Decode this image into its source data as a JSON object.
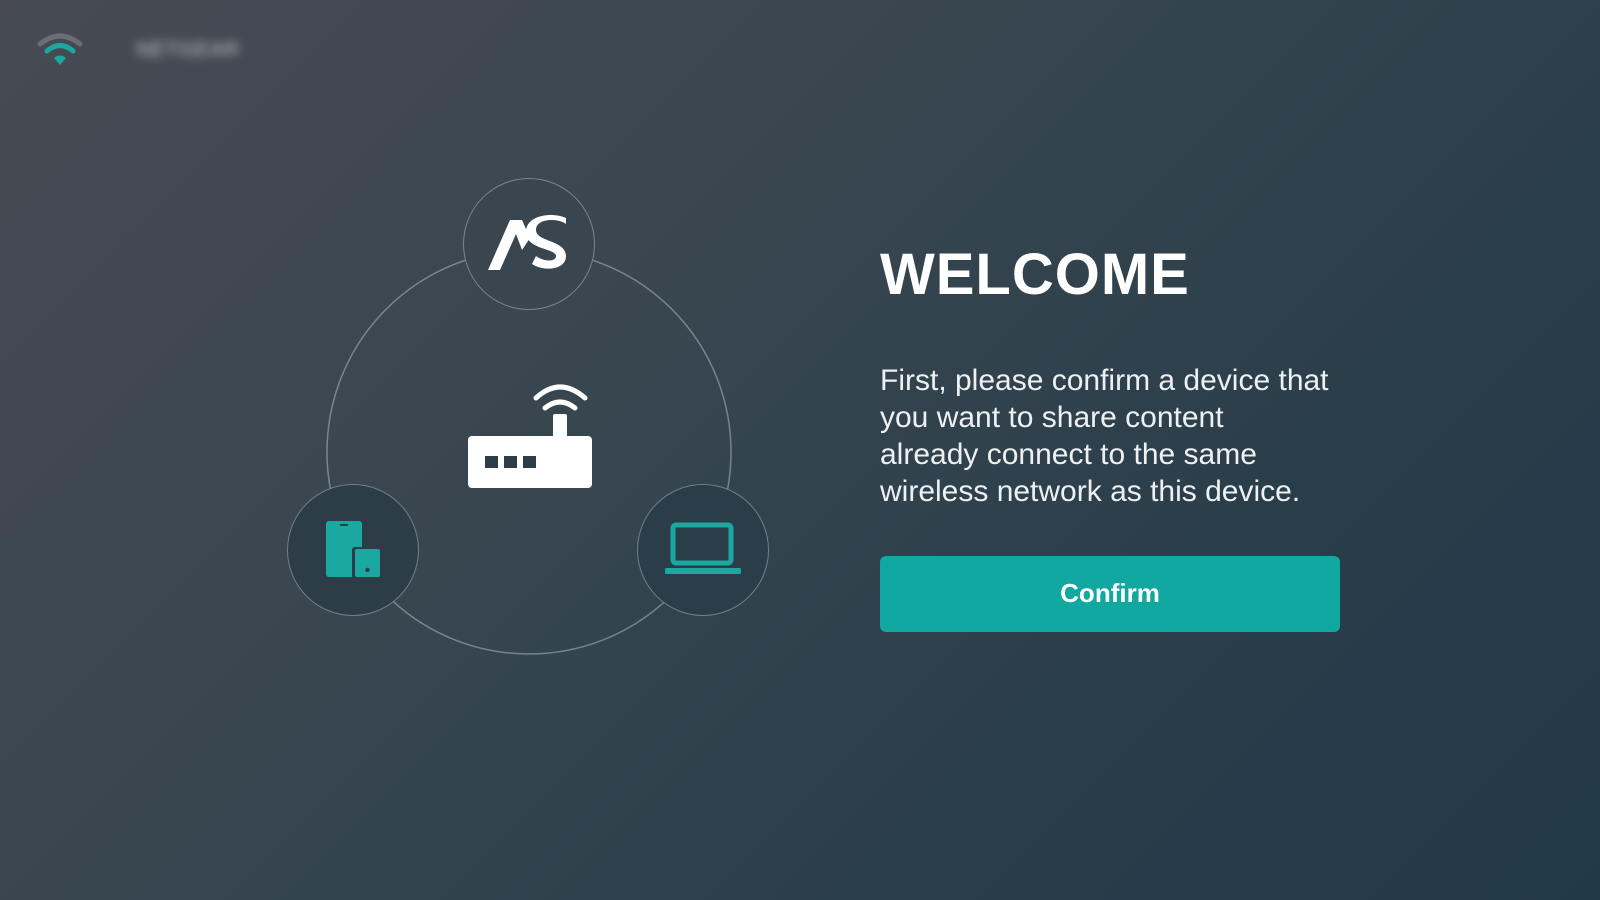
{
  "status_bar": {
    "wifi_icon": "wifi-icon",
    "network_name": "NETGEAR"
  },
  "diagram": {
    "center_icon": "router-icon",
    "nodes": [
      {
        "icon": "as-logo-icon",
        "text": "AS"
      },
      {
        "icon": "mobile-devices-icon"
      },
      {
        "icon": "laptop-icon"
      }
    ]
  },
  "welcome": {
    "title": "WELCOME",
    "description": "First, please confirm a device that you want to share content already connect to the same wireless network as this device.",
    "confirm_label": "Confirm"
  },
  "colors": {
    "accent": "#10a8a0",
    "icon_teal": "#1aa8a0",
    "text": "#ffffff"
  }
}
